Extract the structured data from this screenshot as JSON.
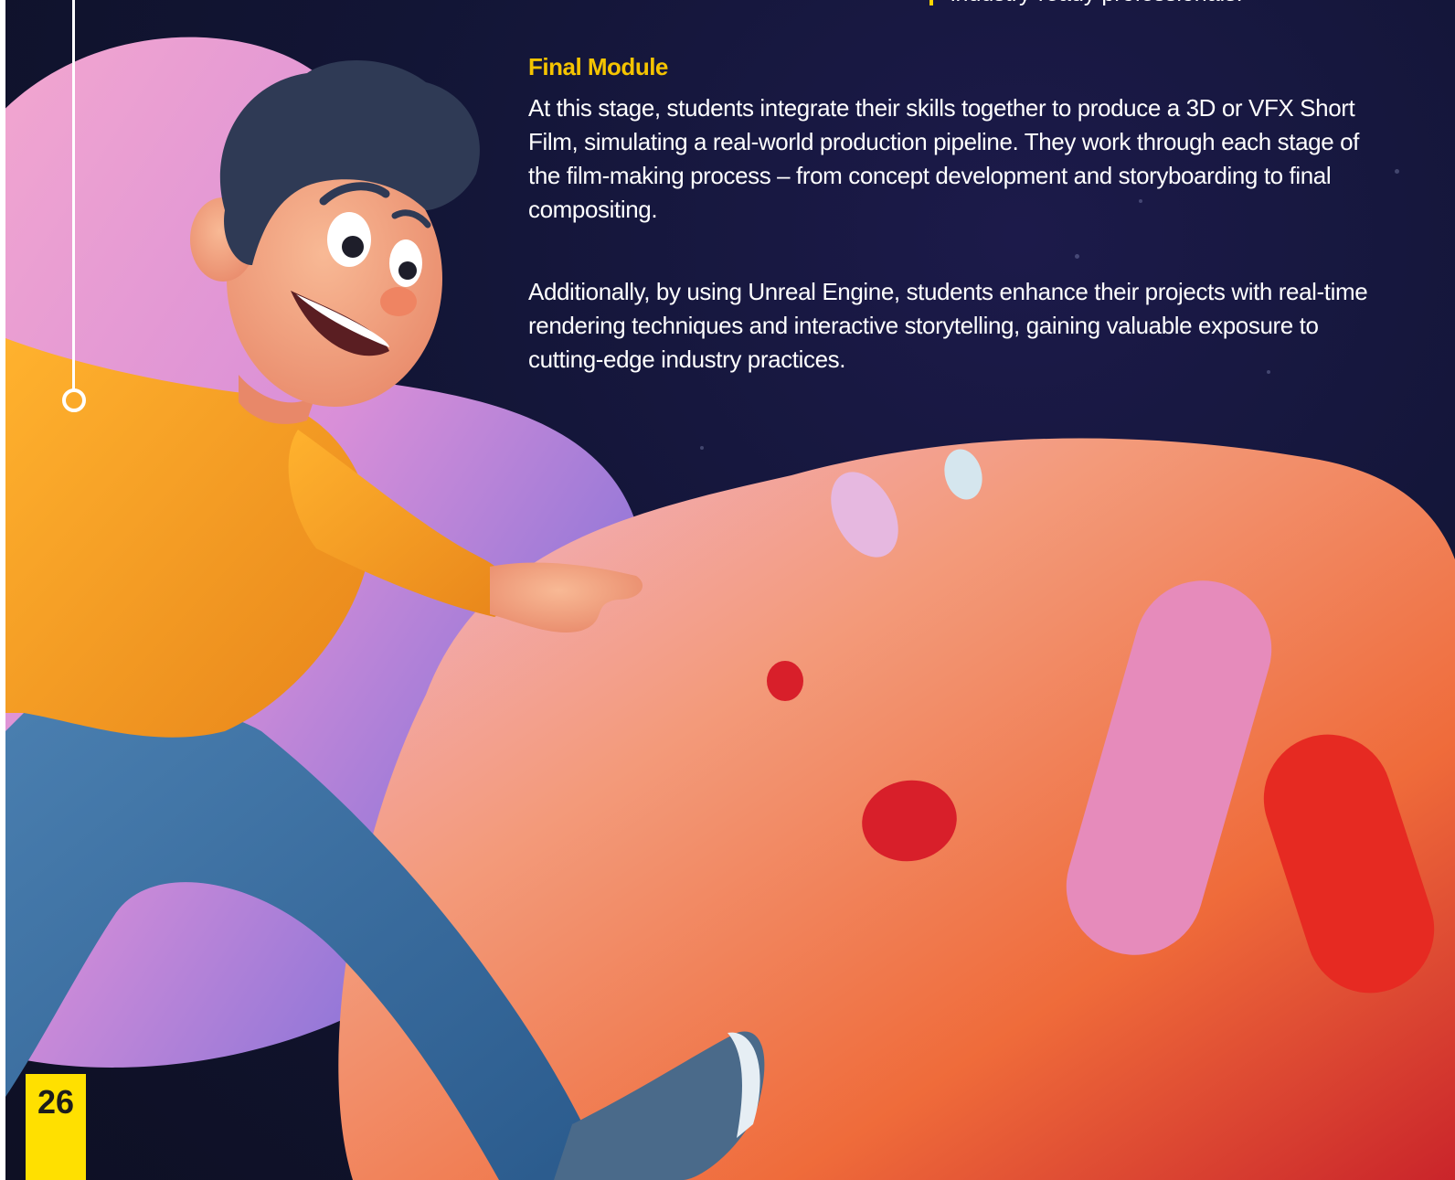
{
  "previous_bullet": {
    "text": "industry-ready professionals."
  },
  "section": {
    "heading": "Final Module",
    "paragraphs": [
      "At this stage, students integrate their skills together to produce a 3D or VFX Short Film, simulating a real-world production pipeline. They work through each stage of the film-making process – from concept development and storyboarding to final compositing.",
      "Additionally, by using Unreal Engine, students enhance their projects with real-time rendering techniques and interactive storytelling, gaining valuable exposure to cutting-edge industry practices."
    ]
  },
  "page_number": "26",
  "colors": {
    "background": "#121535",
    "heading": "#f5c400",
    "body_text": "#ffffff",
    "page_badge": "#ffe000",
    "timeline": "#ffffff"
  }
}
